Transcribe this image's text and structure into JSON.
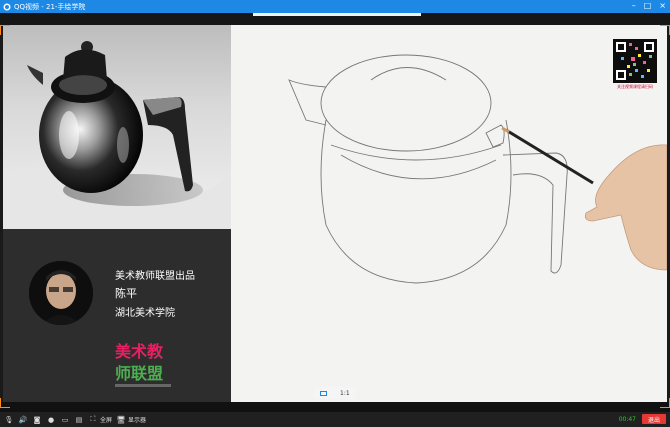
{
  "window": {
    "title": "QQ视频 - 21-手绘学院",
    "controls": [
      "minimize-icon",
      "maximize-icon",
      "close-icon"
    ]
  },
  "left_panel": {
    "caption_line1": "美术教师联盟出品",
    "caption_line2": "陈平",
    "caption_line3": "湖北美术学院",
    "brand_line1": "美术教",
    "brand_line2": "师联盟"
  },
  "qr": {
    "caption": "关注视频课程请扫码"
  },
  "ratio": {
    "label": "1:1"
  },
  "controls": {
    "fullscreen_label": "全屏",
    "screenshare_label": "显示器",
    "time": "00:47",
    "exit_label": "退出"
  },
  "colors": {
    "titlebar": "#1e88e5",
    "accent_orange": "#ff8c1a",
    "exit_red": "#e53935",
    "time_green": "#37c337"
  }
}
